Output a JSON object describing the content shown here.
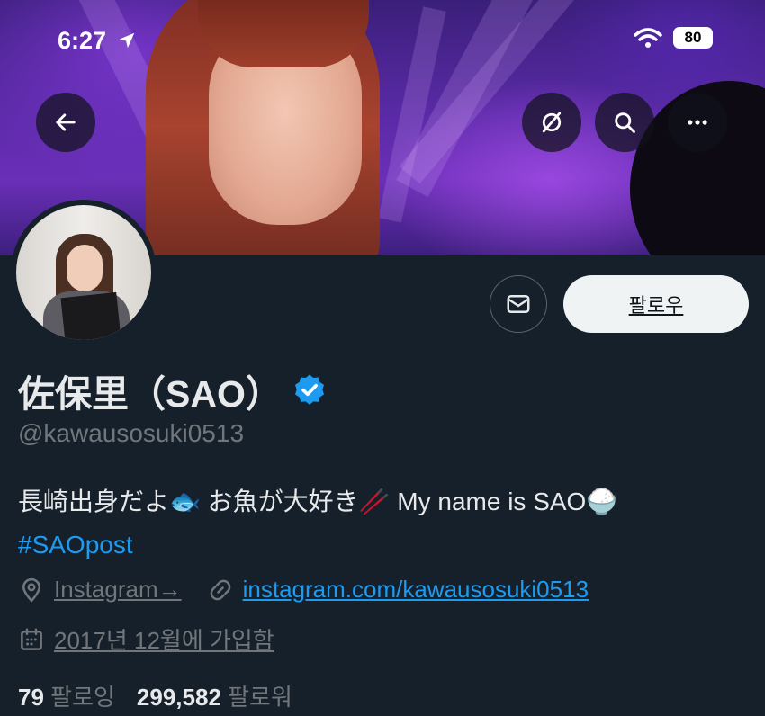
{
  "status_bar": {
    "time": "6:27",
    "battery": "80"
  },
  "profile": {
    "display_name": "佐保里（SAO）",
    "handle": "@kawausosuki0513",
    "bio_line1": "長崎出身だよ🐟 お魚が大好き🥢 My name is SAO🍚",
    "bio_hashtag": "#SAOpost",
    "location": "Instagram→",
    "website": "instagram.com/kawausosuki0513",
    "joined": "2017년 12월에 가입함",
    "following_count": "79",
    "following_label": "팔로잉",
    "followers_count": "299,582",
    "followers_label": "팔로워"
  },
  "actions": {
    "follow_label": "팔로우"
  },
  "colors": {
    "background": "#15202b",
    "accent": "#1d9bf0",
    "muted": "#71767b",
    "follow_bg": "#eff3f4"
  },
  "icons": [
    "back-arrow-icon",
    "grok-icon",
    "search-icon",
    "more-icon",
    "mail-icon",
    "verified-badge-icon",
    "location-pin-icon",
    "link-icon",
    "calendar-icon",
    "navigation-arrow-icon",
    "wifi-icon"
  ]
}
